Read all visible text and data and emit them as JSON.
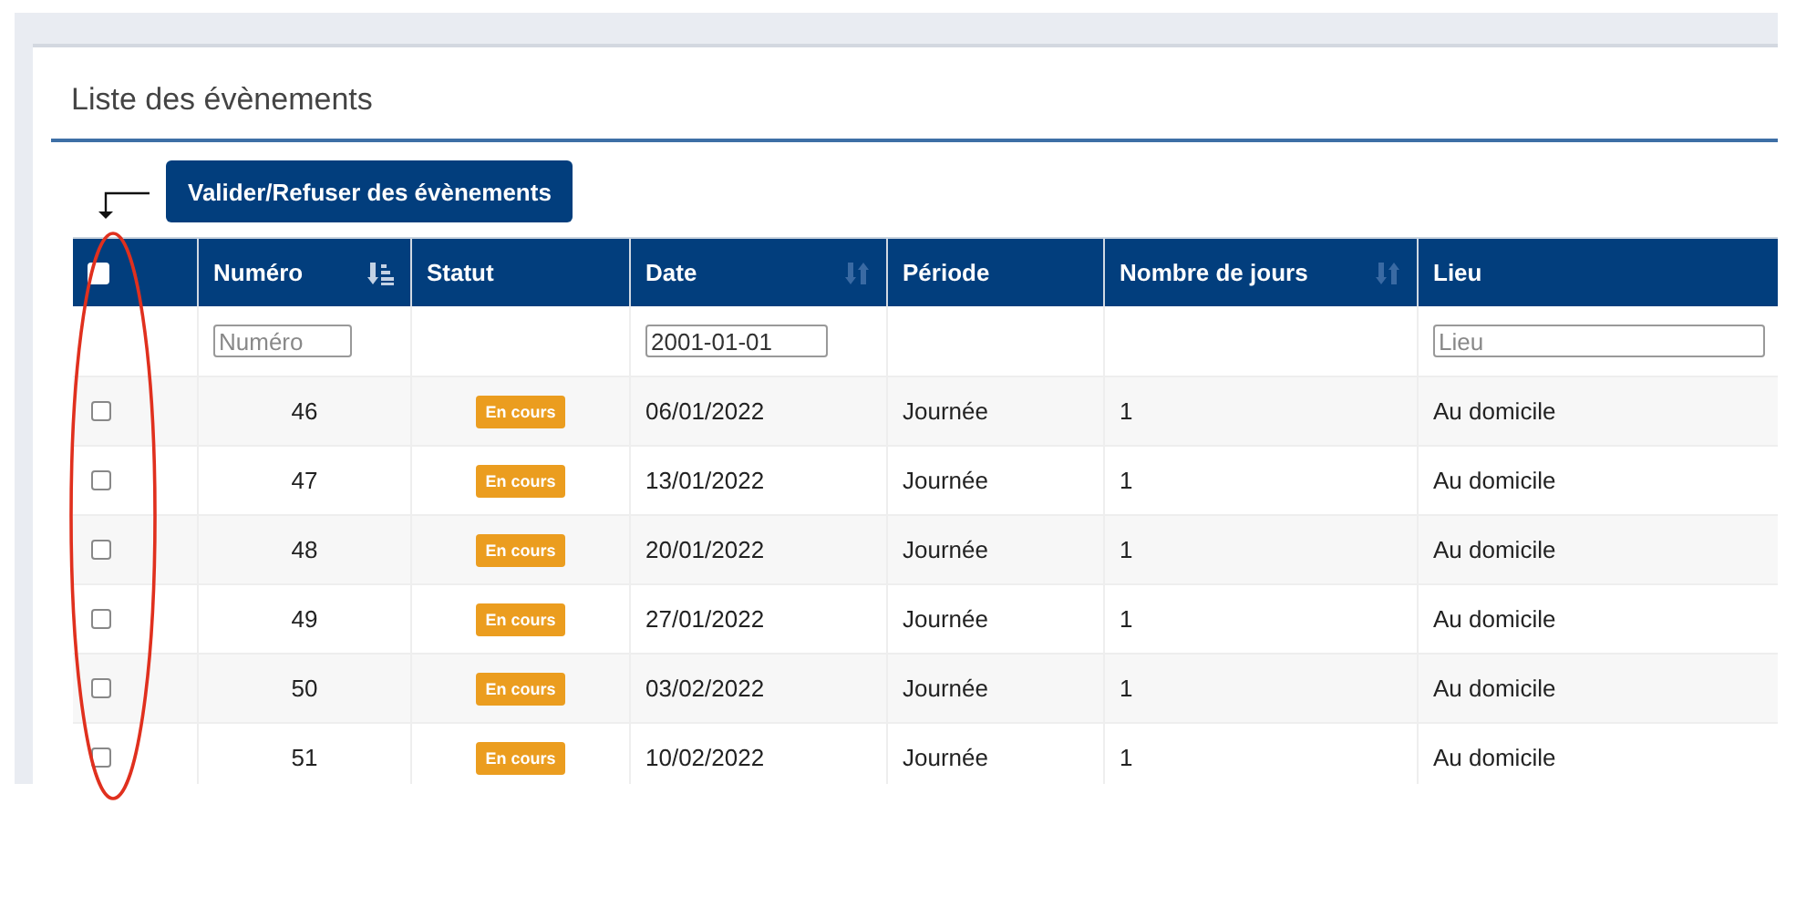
{
  "panel": {
    "title": "Liste des évènements",
    "action_button": "Valider/Refuser des évènements"
  },
  "table": {
    "columns": [
      {
        "kind": "checkbox",
        "checked": false
      },
      {
        "kind": "text",
        "label": "Numéro",
        "sortable": true,
        "sorted": true,
        "filter": {
          "placeholder": "Numéro"
        }
      },
      {
        "kind": "text",
        "label": "Statut",
        "sortable": false
      },
      {
        "kind": "text",
        "label": "Date",
        "sortable": true,
        "sorted": false,
        "filter": {
          "value": "2001-01-01"
        }
      },
      {
        "kind": "text",
        "label": "Période",
        "sortable": false
      },
      {
        "kind": "text",
        "label": "Nombre de jours",
        "sortable": true,
        "sorted": false
      },
      {
        "kind": "text",
        "label": "Lieu",
        "sortable": false,
        "filter": {
          "placeholder": "Lieu"
        }
      }
    ],
    "rows": [
      {
        "checked": false,
        "number": "46",
        "status": "En cours",
        "date": "06/01/2022",
        "period": "Journée",
        "days": "1",
        "place": "Au domicile"
      },
      {
        "checked": false,
        "number": "47",
        "status": "En cours",
        "date": "13/01/2022",
        "period": "Journée",
        "days": "1",
        "place": "Au domicile"
      },
      {
        "checked": false,
        "number": "48",
        "status": "En cours",
        "date": "20/01/2022",
        "period": "Journée",
        "days": "1",
        "place": "Au domicile"
      },
      {
        "checked": false,
        "number": "49",
        "status": "En cours",
        "date": "27/01/2022",
        "period": "Journée",
        "days": "1",
        "place": "Au domicile"
      },
      {
        "checked": false,
        "number": "50",
        "status": "En cours",
        "date": "03/02/2022",
        "period": "Journée",
        "days": "1",
        "place": "Au domicile"
      },
      {
        "checked": false,
        "number": "51",
        "status": "En cours",
        "date": "10/02/2022",
        "period": "Journée",
        "days": "1",
        "place": "Au domicile"
      }
    ]
  }
}
